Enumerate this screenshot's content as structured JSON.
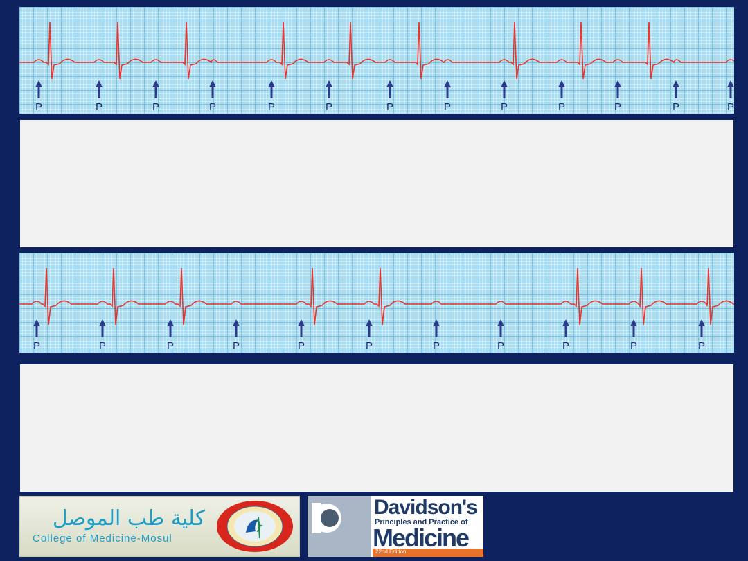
{
  "strip1": {
    "p_label": "P",
    "p_count": 13
  },
  "strip2": {
    "p_label": "P",
    "p_count": 11
  },
  "colors": {
    "background": "#0e2260",
    "trace": "#e8352e",
    "arrow": "#2c3a8c",
    "grid": "#a9dcef",
    "panel": "#f2f2f2"
  },
  "logos": {
    "mosul_arabic": "كلية طب الموصل",
    "mosul_english": "College of Medicine-Mosul",
    "davidson_title": "Davidson's",
    "davidson_subtitle": "Principles and Practice of",
    "davidson_medicine": "Medicine",
    "davidson_edition": "22nd Edition"
  }
}
